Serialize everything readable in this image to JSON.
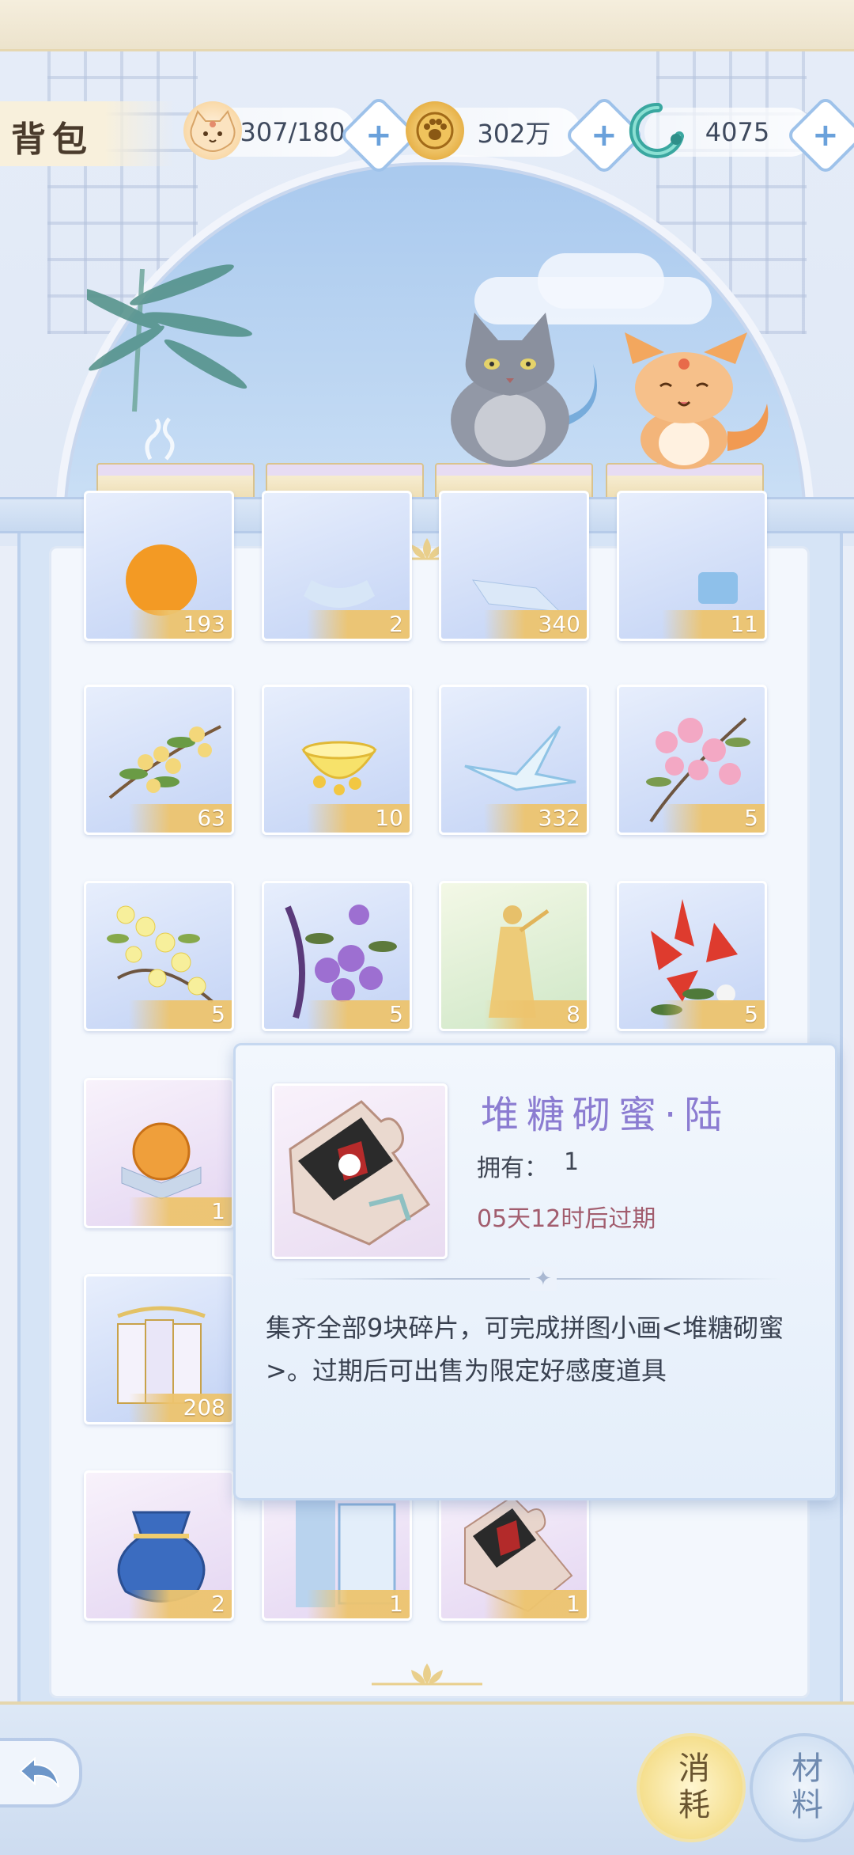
{
  "header": {
    "title": "背包",
    "currencies": [
      {
        "icon": "cat-stamina-icon",
        "value": "307/180"
      },
      {
        "icon": "paw-coin-icon",
        "value": "302万"
      },
      {
        "icon": "jade-dragon-icon",
        "value": "4075"
      }
    ],
    "plus_label": "+"
  },
  "items": [
    {
      "icon": "orange-orb-icon",
      "count": "193"
    },
    {
      "icon": "glass-item-icon",
      "count": "2"
    },
    {
      "icon": "crystal-item-icon",
      "count": "340"
    },
    {
      "icon": "blue-bottle-icon",
      "count": "11"
    },
    {
      "icon": "osmanthus-branch-icon",
      "count": "63"
    },
    {
      "icon": "tea-cup-icon",
      "count": "10"
    },
    {
      "icon": "paper-crane-icon",
      "count": "332"
    },
    {
      "icon": "peach-blossom-icon",
      "count": "5"
    },
    {
      "icon": "yellow-blossom-icon",
      "count": "5"
    },
    {
      "icon": "purple-flower-icon",
      "count": "5"
    },
    {
      "icon": "golden-figure-icon",
      "count": "8"
    },
    {
      "icon": "red-lily-icon",
      "count": "5"
    },
    {
      "icon": "amber-orb-icon",
      "count": "1"
    },
    {
      "icon": "letters-bundle-icon",
      "count": "208"
    },
    {
      "icon": "blue-pouch-icon",
      "count": "2"
    },
    {
      "icon": "blue-envelope-icon",
      "count": "1"
    },
    {
      "icon": "puzzle-piece-icon",
      "count": "1"
    }
  ],
  "tooltip": {
    "name": "堆糖砌蜜·陆",
    "owned_label": "拥有：",
    "owned_value": "1",
    "expire": "05天12时后过期",
    "description": "集齐全部9块碎片，可完成拼图小画<堆糖砌蜜>。过期后可出售为限定好感度道具"
  },
  "bottom": {
    "consume_label": "消耗",
    "material_label": "材料"
  }
}
